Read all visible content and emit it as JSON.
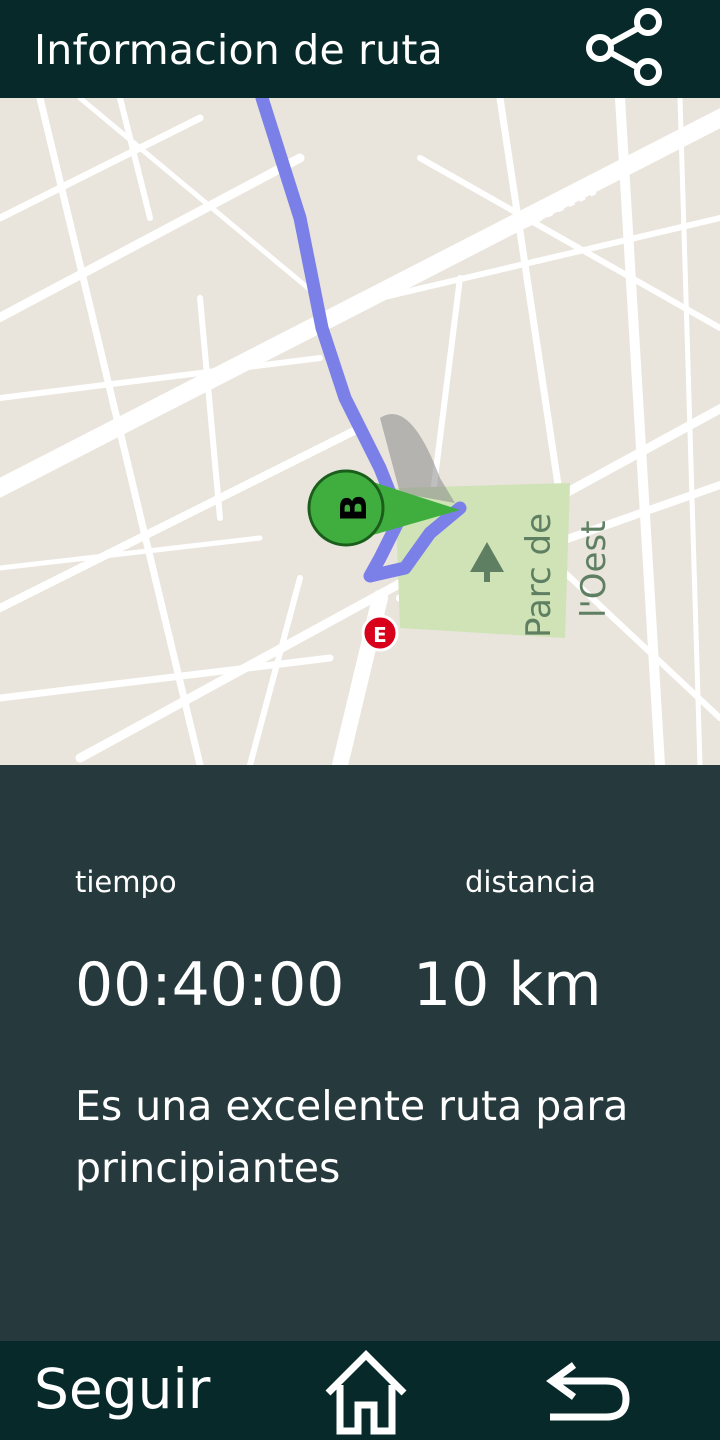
{
  "header": {
    "title": "Informacion de ruta",
    "share_icon": "share-icon"
  },
  "map": {
    "park_label_line1": "Parc de",
    "park_label_line2": "l'Oest",
    "marker_letter": "B",
    "route_color": "#7b7fe8",
    "marker_color": "#3fae3f",
    "park_color": "#cfe3b6"
  },
  "info": {
    "time_label": "tiempo",
    "time_value": "00:40:00",
    "distance_label": "distancia",
    "distance_value": "10 km",
    "description": "Es una excelente ruta para principiantes"
  },
  "footer": {
    "follow_label": "Seguir",
    "home_icon": "home-icon",
    "back_icon": "back-icon"
  }
}
